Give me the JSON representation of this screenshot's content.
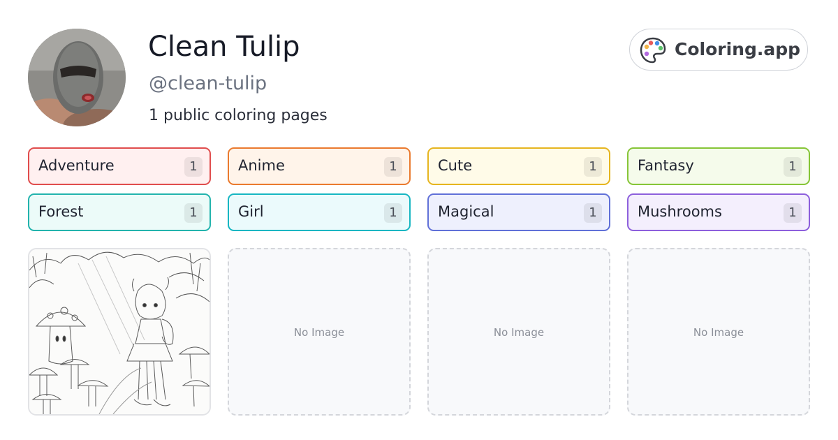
{
  "profile": {
    "name": "Clean Tulip",
    "handle": "@clean-tulip",
    "count_text": "1 public coloring pages"
  },
  "brand": {
    "label": "Coloring.app",
    "icon": "palette-icon"
  },
  "tags": [
    {
      "label": "Adventure",
      "count": "1",
      "border": "#e04d4d",
      "bg": "#fff0f0"
    },
    {
      "label": "Anime",
      "count": "1",
      "border": "#ea7a2e",
      "bg": "#fff4ea"
    },
    {
      "label": "Cute",
      "count": "1",
      "border": "#e6b51f",
      "bg": "#fffbe8"
    },
    {
      "label": "Fantasy",
      "count": "1",
      "border": "#86c537",
      "bg": "#f5fbeb"
    },
    {
      "label": "Forest",
      "count": "1",
      "border": "#22b3ad",
      "bg": "#ecfbf9"
    },
    {
      "label": "Girl",
      "count": "1",
      "border": "#16b6c2",
      "bg": "#ebfafc"
    },
    {
      "label": "Magical",
      "count": "1",
      "border": "#6070d8",
      "bg": "#eef0fd"
    },
    {
      "label": "Mushrooms",
      "count": "1",
      "border": "#8d5fdc",
      "bg": "#f4effd"
    }
  ],
  "cards": [
    {
      "type": "image",
      "description_icon": "coloring-page-thumbnail"
    },
    {
      "type": "empty",
      "text": "No Image"
    },
    {
      "type": "empty",
      "text": "No Image"
    },
    {
      "type": "empty",
      "text": "No Image"
    }
  ]
}
